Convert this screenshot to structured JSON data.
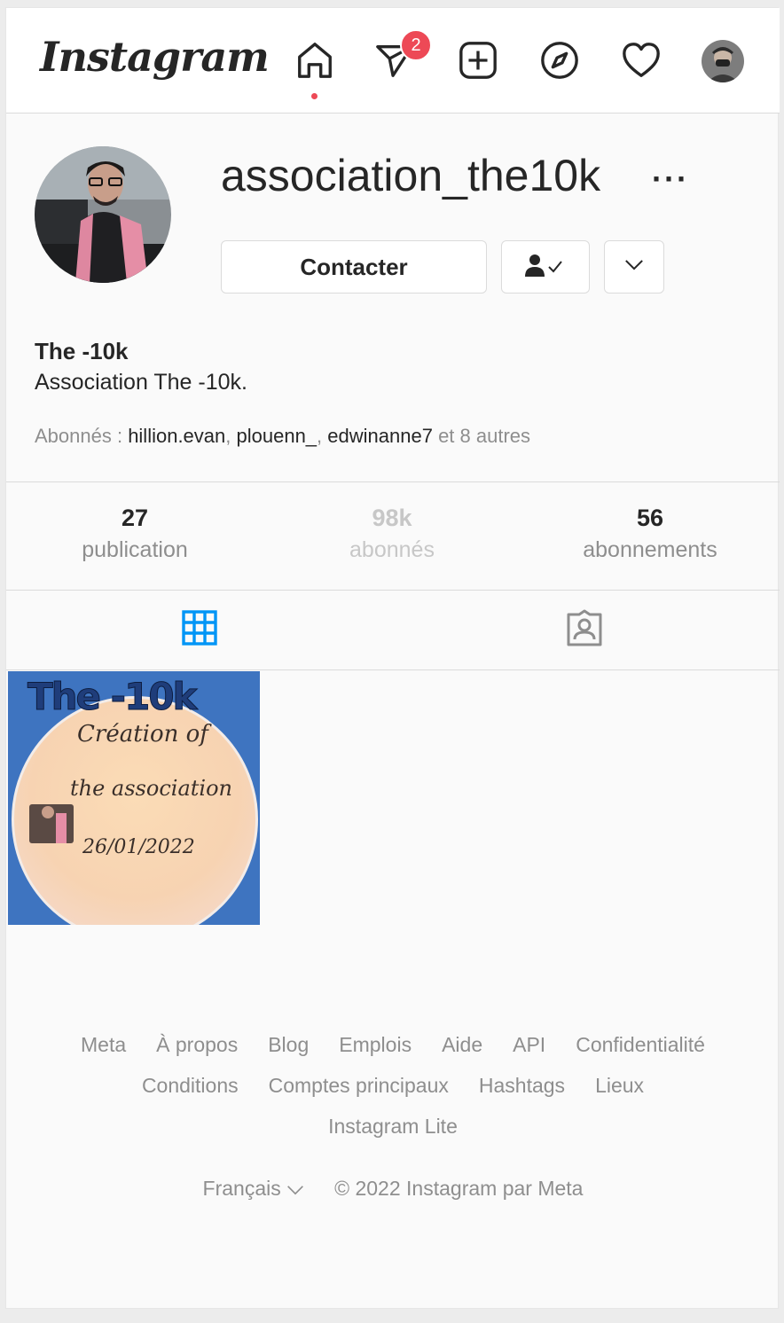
{
  "header": {
    "logo": "Instagram",
    "messages_badge": "2"
  },
  "profile": {
    "username": "association_the10k",
    "more_label": "···",
    "contact_button": "Contacter",
    "full_name": "The -10k",
    "bio": "Association The -10k.",
    "followed_by_prefix": "Abonnés : ",
    "followers_shown": [
      "hillion.evan",
      "plouenn_",
      "edwinanne7"
    ],
    "followed_by_suffix": " et 8 autres"
  },
  "stats": [
    {
      "value": "27",
      "label": "publication"
    },
    {
      "value": "98k",
      "label": "abonnés"
    },
    {
      "value": "56",
      "label": "abonnements"
    }
  ],
  "post": {
    "title": "The -10k",
    "line1": "Création of",
    "line2": "the association",
    "date": "26/01/2022"
  },
  "footer": {
    "row1": [
      "Meta",
      "À propos",
      "Blog",
      "Emplois",
      "Aide",
      "API",
      "Confidentialité"
    ],
    "row2": [
      "Conditions",
      "Comptes principaux",
      "Hashtags",
      "Lieux"
    ],
    "row3": [
      "Instagram Lite"
    ],
    "language": "Français",
    "copyright": "© 2022 Instagram par Meta"
  },
  "colors": {
    "accent_blue": "#0095f6",
    "badge_red": "#ed4956",
    "text": "#262626",
    "muted": "#8e8e8e"
  }
}
